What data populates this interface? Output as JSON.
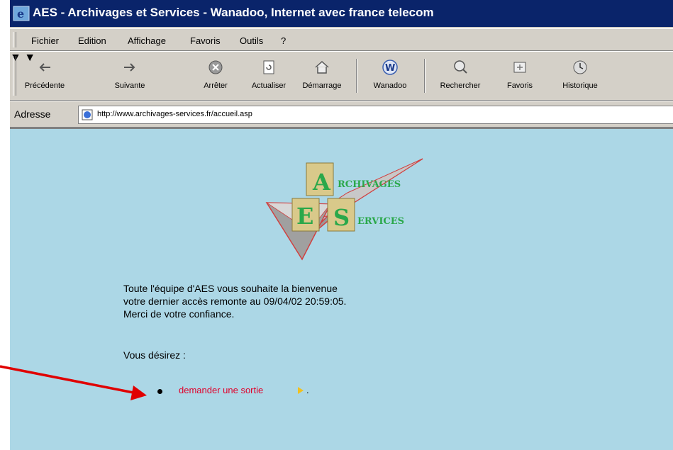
{
  "window": {
    "title": "AES - Archivages et Services - Wanadoo, Internet avec france telecom"
  },
  "menu": [
    "Fichier",
    "Edition",
    "Affichage",
    "Favoris",
    "Outils",
    "?"
  ],
  "toolbar": {
    "back": "Précédente",
    "forward": "Suivante",
    "stop": "Arrêter",
    "refresh": "Actualiser",
    "home": "Démarrage",
    "wanadoo": "Wanadoo",
    "search": "Rechercher",
    "favorites": "Favoris",
    "history": "Historique"
  },
  "address": {
    "label": "Adresse",
    "url": "http://www.archivages-services.fr/accueil.asp"
  },
  "logo": {
    "letter_a": "A",
    "rest_a": "RCHIVAGES",
    "letter_e": "E",
    "letter_s": "S",
    "rest_s": "ERVICES"
  },
  "content": {
    "welcome_lines": [
      "Toute l'équipe d'AES vous souhaite la bienvenue",
      "votre dernier accès remonte au 09/04/02 20:59:05.",
      "Merci de votre confiance."
    ],
    "prompt": "Vous désirez :",
    "link": "demander une sortie",
    "after_link": "."
  },
  "colors": {
    "titlebar": "#0a246a",
    "content_bg": "#acd7e6",
    "link": "#e0002a",
    "logo_green": "#2aa84a",
    "annotation_arrow": "#e00000"
  }
}
